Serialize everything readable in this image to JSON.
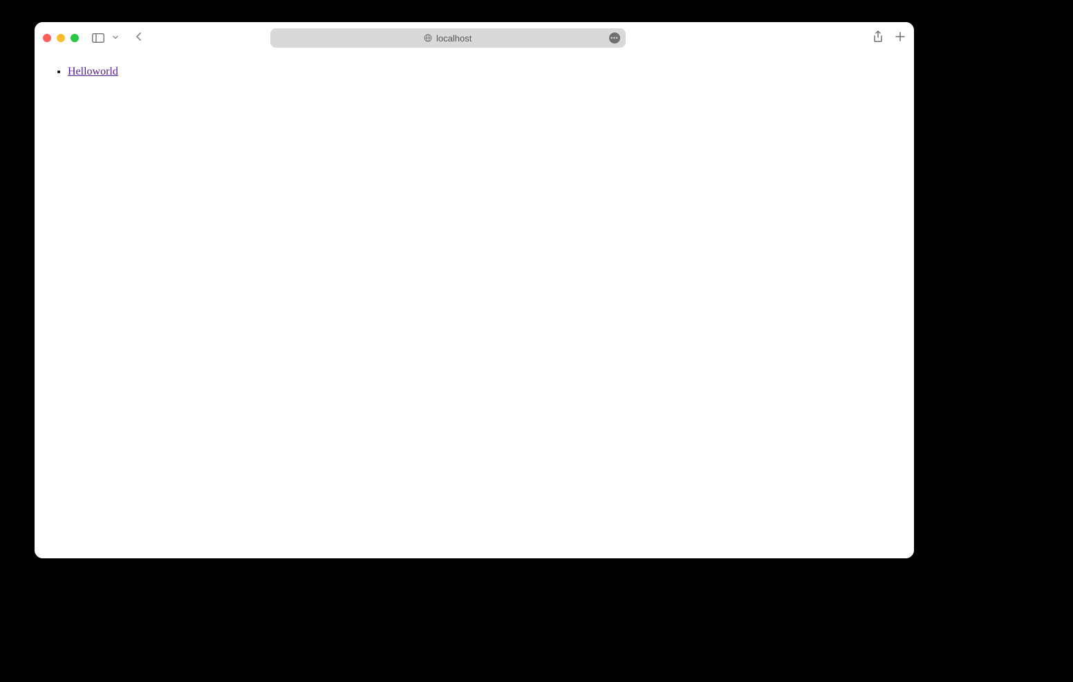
{
  "address_bar": {
    "host": "localhost"
  },
  "page": {
    "links": [
      {
        "text": "Helloworld"
      }
    ]
  }
}
